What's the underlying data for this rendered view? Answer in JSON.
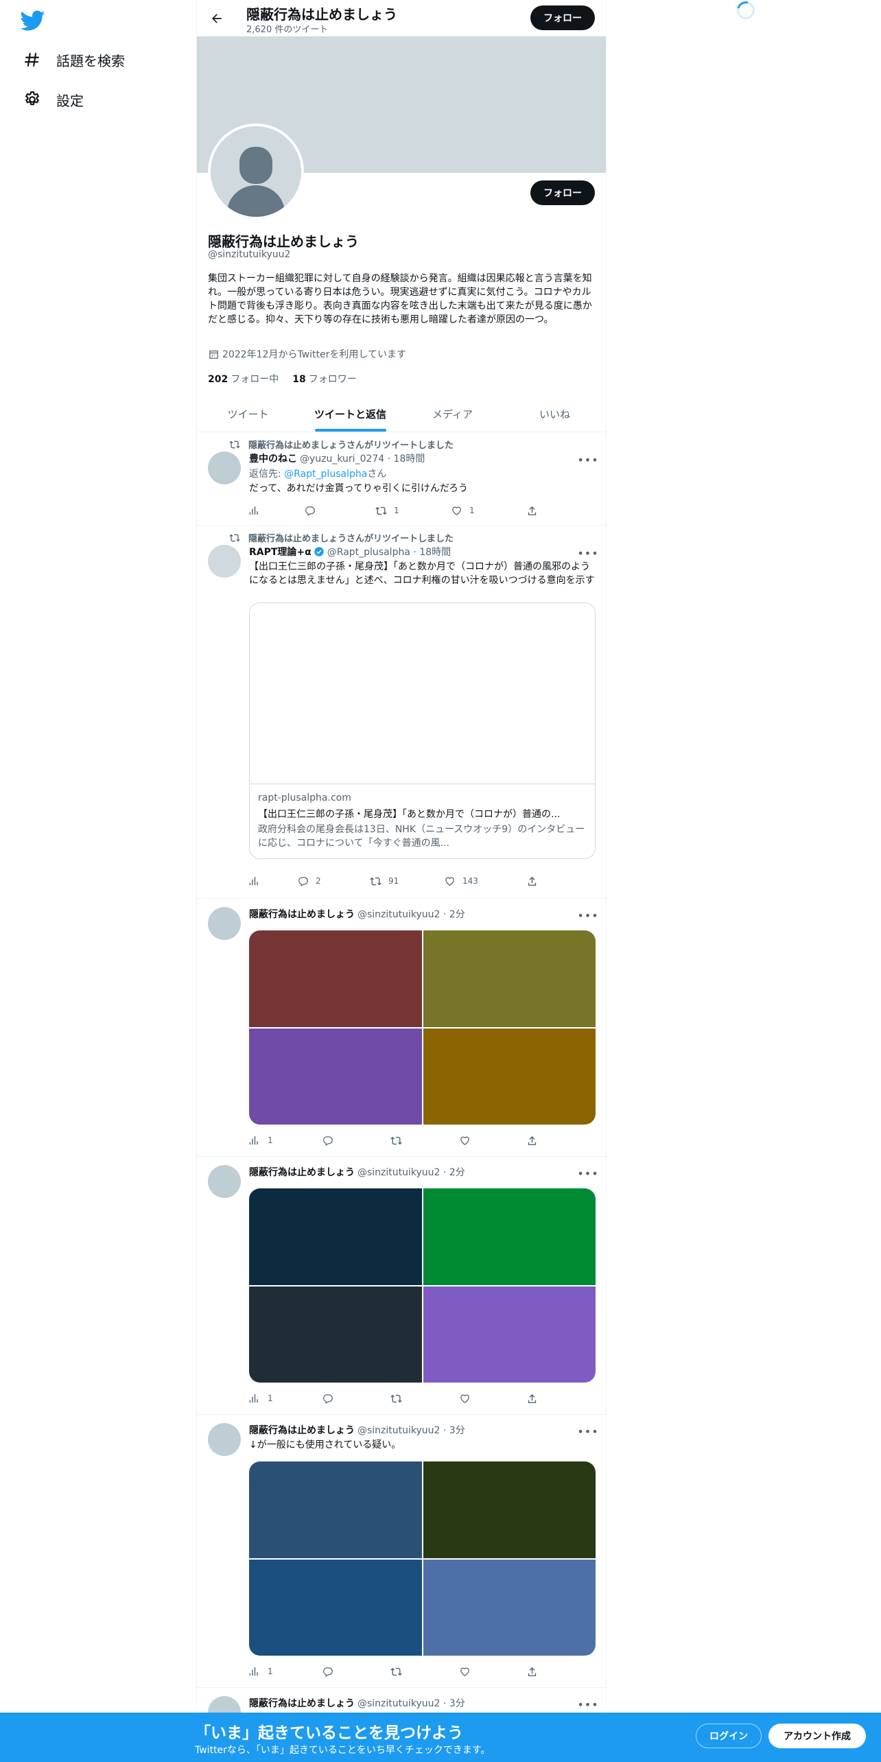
{
  "nav": {
    "explore_label": "話題を検索",
    "settings_label": "設定"
  },
  "header": {
    "title": "隠蔽行為は止めましょう",
    "subtitle": "2,620 件のツイート",
    "follow_label": "フォロー"
  },
  "profile": {
    "name": "隠蔽行為は止めましょう",
    "handle": "@sinzitutuikyuu2",
    "bio": "集団ストーカー組織犯罪に対して自身の経験談から発言。組織は因果応報と言う言葉を知れ。一般が思っている寄り日本は危うい。現実逃避せずに真実に気付こう。コロナやカルト問題で背後も浮き彫り。表向き真面な内容を呟き出した末端も出て来たが見る度に愚かだと感じる。抑々、天下り等の存在に技術も悪用し暗躍した者達が原因の一つ。",
    "joined": "2022年12月からTwitterを利用しています",
    "following_count": "202",
    "following_label": "フォロー中",
    "followers_count": "18",
    "followers_label": "フォロワー",
    "follow_label": "フォロー"
  },
  "tabs": [
    {
      "label": "ツイート",
      "active": false
    },
    {
      "label": "ツイートと返信",
      "active": true
    },
    {
      "label": "メディア",
      "active": false
    },
    {
      "label": "いいね",
      "active": false
    }
  ],
  "tweets": [
    {
      "retweet_line": "隠蔽行為は止めましょうさんがリツイートしました",
      "name": "豊中のねこ",
      "handle": "@yuzu_kuri_0274 · 18時間",
      "reply_prefix": "返信先: ",
      "reply_to": "@Rapt_plusalpha",
      "reply_suffix": "さん",
      "text": "だって、あれだけ金貰ってりゃ引くに引けんだろう",
      "views": "",
      "replies": "",
      "retweets": "1",
      "likes": "1"
    },
    {
      "retweet_line": "隠蔽行為は止めましょうさんがリツイートしました",
      "name": "RAPT理論+α",
      "handle": "@Rapt_plusalpha · 18時間",
      "text": "【出口王仁三郎の子孫・尾身茂】「あと数か月で（コロナが）普通の風邪のようになるとは思えません」と述べ、コロナ利権の甘い汁を吸いつづける意向を示す",
      "card_domain": "rapt-plusalpha.com",
      "card_title": "【出口王仁三郎の子孫・尾身茂】「あと数か月で（コロナが）普通の...",
      "card_desc": "政府分科会の尾身会長は13日、NHK（ニュースウオッチ9）のインタビューに応じ、コロナについて「今すぐ普通の風...",
      "views": "",
      "replies": "2",
      "retweets": "91",
      "likes": "143"
    },
    {
      "name": "隠蔽行為は止めましょう",
      "handle": "@sinzitutuikyuu2 · 2分",
      "text": "",
      "images": [
        "#773636",
        "#767528",
        "#704ba8",
        "#8a6400"
      ],
      "views": "1",
      "replies": "",
      "retweets": "",
      "likes": ""
    },
    {
      "name": "隠蔽行為は止めましょう",
      "handle": "@sinzitutuikyuu2 · 2分",
      "text": "",
      "images": [
        "#0a2c3e",
        "#008a33",
        "#1f2d36",
        "#7f5cc4"
      ],
      "views": "1",
      "replies": "",
      "retweets": "",
      "likes": ""
    },
    {
      "name": "隠蔽行為は止めましょう",
      "handle": "@sinzitutuikyuu2 · 3分",
      "text": "↓が一般にも使用されている疑い。",
      "images": [
        "#2a5175",
        "#283a14",
        "#1b4f7f",
        "#4d70a8"
      ],
      "views": "1",
      "replies": "",
      "retweets": "",
      "likes": ""
    },
    {
      "name": "隠蔽行為は止めましょう",
      "handle": "@sinzitutuikyuu2 · 3分"
    }
  ],
  "bottombar": {
    "title": "「いま」起きていることを見つけよう",
    "subtitle": "Twitterなら、「いま」起きていることをいち早くチェックできます。",
    "login_label": "ログイン",
    "signup_label": "アカウント作成"
  },
  "colors": {
    "accent": "#1d9bf0",
    "text": "#0f1419",
    "muted": "#536471",
    "banner": "#cfd9de"
  }
}
